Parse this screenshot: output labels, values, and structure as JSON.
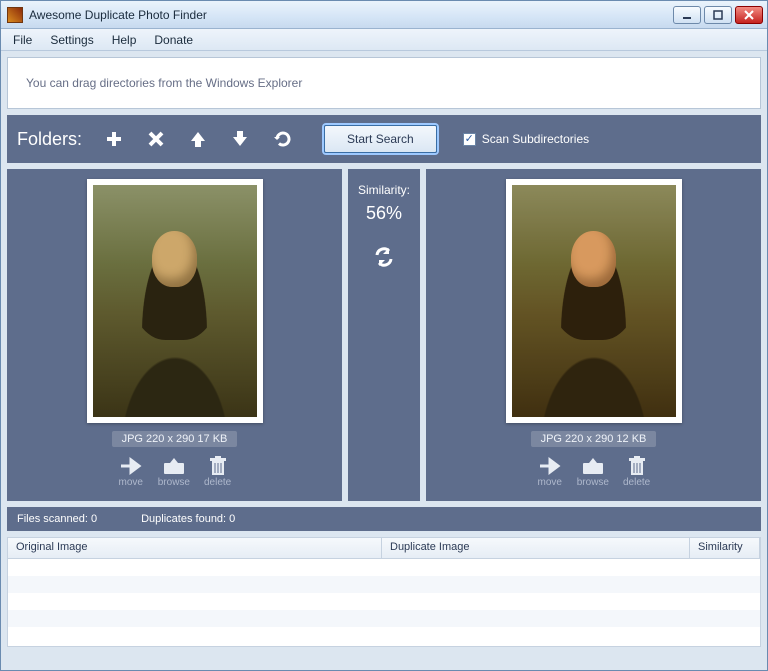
{
  "window": {
    "title": "Awesome Duplicate Photo Finder"
  },
  "menu": {
    "file": "File",
    "settings": "Settings",
    "help": "Help",
    "donate": "Donate"
  },
  "hint": "You can drag directories from the Windows Explorer",
  "toolbar": {
    "label": "Folders:",
    "start_label": "Start Search",
    "scan_sub_label": "Scan Subdirectories",
    "scan_sub_checked": true
  },
  "similarity": {
    "label": "Similarity:",
    "value": "56%"
  },
  "left": {
    "meta": "JPG  220 x 290  17 KB",
    "actions": {
      "move": "move",
      "browse": "browse",
      "delete": "delete"
    }
  },
  "right": {
    "meta": "JPG  220 x 290  12 KB",
    "actions": {
      "move": "move",
      "browse": "browse",
      "delete": "delete"
    }
  },
  "status": {
    "scanned": "Files scanned: 0",
    "dups": "Duplicates found: 0"
  },
  "table": {
    "col_orig": "Original Image",
    "col_dup": "Duplicate Image",
    "col_sim": "Similarity"
  }
}
